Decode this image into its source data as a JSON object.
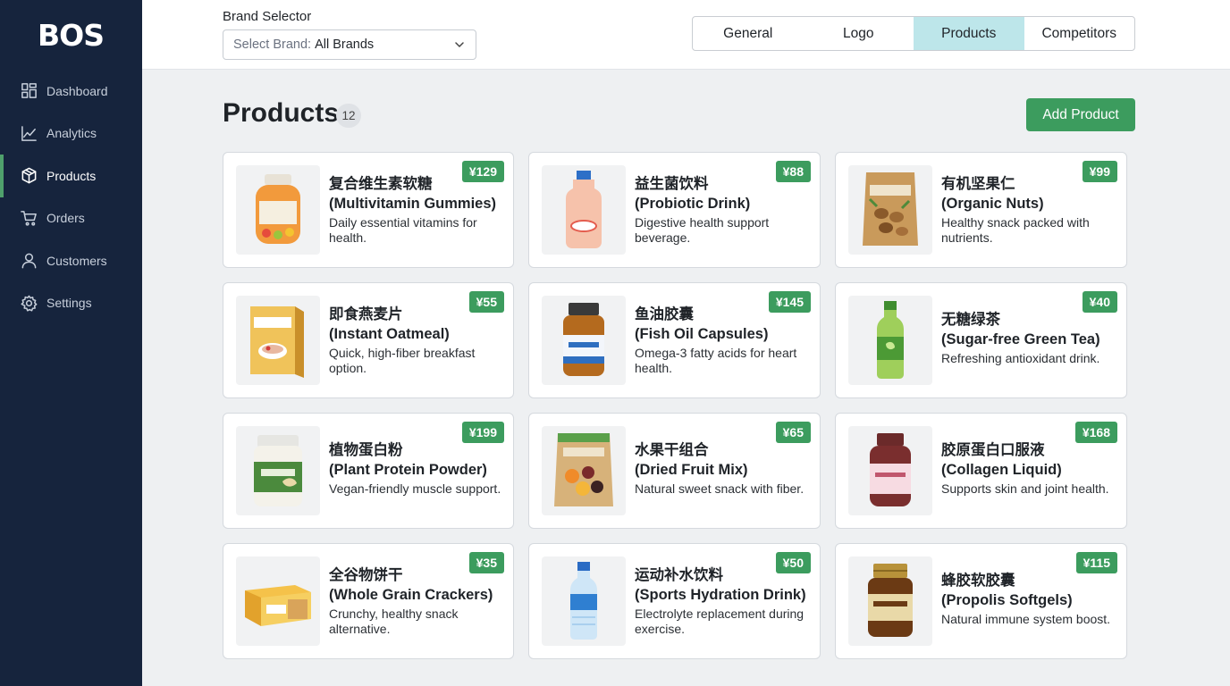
{
  "app": {
    "logo": "BOS"
  },
  "sidebar": {
    "items": [
      {
        "label": "Dashboard",
        "icon": "dashboard-icon",
        "active": false
      },
      {
        "label": "Analytics",
        "icon": "chart-line-icon",
        "active": false
      },
      {
        "label": "Products",
        "icon": "box-icon",
        "active": true
      },
      {
        "label": "Orders",
        "icon": "cart-icon",
        "active": false
      },
      {
        "label": "Customers",
        "icon": "user-icon",
        "active": false
      },
      {
        "label": "Settings",
        "icon": "gear-icon",
        "active": false
      }
    ]
  },
  "header": {
    "brand_label": "Brand Selector",
    "brand_select_prefix": "Select Brand:",
    "brand_select_value": "All Brands",
    "tabs": [
      {
        "label": "General",
        "active": false
      },
      {
        "label": "Logo",
        "active": false
      },
      {
        "label": "Products",
        "active": true
      },
      {
        "label": "Competitors",
        "active": false
      }
    ]
  },
  "main": {
    "title": "Products",
    "count": "12",
    "add_button": "Add Product",
    "colors": {
      "accent_green": "#3c9c5e",
      "sidebar_bg": "#16243d",
      "active_tab_bg": "#bde6ea"
    },
    "products": [
      {
        "name_cn": "复合维生素软糖",
        "name_en": "(Multivitamin Gummies)",
        "desc": "Daily essential vitamins for health.",
        "price": "¥129",
        "image": "gummies-jar"
      },
      {
        "name_cn": "益生菌饮料",
        "name_en": "(Probiotic Drink)",
        "desc": "Digestive health support beverage.",
        "price": "¥88",
        "image": "probiotic-bottle"
      },
      {
        "name_cn": "有机坚果仁",
        "name_en": "(Organic Nuts)",
        "desc": "Healthy snack packed with nutrients.",
        "price": "¥99",
        "image": "nut-pouch"
      },
      {
        "name_cn": "即食燕麦片",
        "name_en": "(Instant Oatmeal)",
        "desc": "Quick, high-fiber breakfast option.",
        "price": "¥55",
        "image": "oatmeal-box"
      },
      {
        "name_cn": "鱼油胶囊",
        "name_en": "(Fish Oil Capsules)",
        "desc": "Omega-3 fatty acids for heart health.",
        "price": "¥145",
        "image": "capsule-bottle"
      },
      {
        "name_cn": "无糖绿茶",
        "name_en": "(Sugar-free Green Tea)",
        "desc": "Refreshing antioxidant drink.",
        "price": "¥40",
        "image": "tea-bottle"
      },
      {
        "name_cn": "植物蛋白粉",
        "name_en": "(Plant Protein Powder)",
        "desc": "Vegan-friendly muscle support.",
        "price": "¥199",
        "image": "protein-tub"
      },
      {
        "name_cn": "水果干组合",
        "name_en": "(Dried Fruit Mix)",
        "desc": "Natural sweet snack with fiber.",
        "price": "¥65",
        "image": "fruit-pouch"
      },
      {
        "name_cn": "胶原蛋白口服液",
        "name_en": "(Collagen Liquid)",
        "desc": "Supports skin and joint health.",
        "price": "¥168",
        "image": "collagen-bottle"
      },
      {
        "name_cn": "全谷物饼干",
        "name_en": "(Whole Grain Crackers)",
        "desc": "Crunchy, healthy snack alternative.",
        "price": "¥35",
        "image": "cracker-box"
      },
      {
        "name_cn": "运动补水饮料",
        "name_en": "(Sports Hydration Drink)",
        "desc": "Electrolyte replacement during exercise.",
        "price": "¥50",
        "image": "water-bottle"
      },
      {
        "name_cn": "蜂胶软胶囊",
        "name_en": "(Propolis Softgels)",
        "desc": "Natural immune system boost.",
        "price": "¥115",
        "image": "propolis-jar"
      }
    ]
  }
}
